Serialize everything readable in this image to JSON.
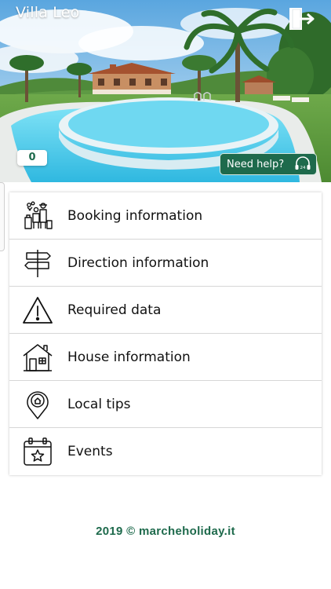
{
  "header": {
    "title": "Villa Leo",
    "exit_icon": "logout-icon"
  },
  "hero": {
    "counter": "0",
    "help_label": "Need help?",
    "help_icon": "headset-24-icon"
  },
  "menu": {
    "items": [
      {
        "label": "Booking information",
        "icon": "travelers-icon"
      },
      {
        "label": "Direction information",
        "icon": "signpost-icon"
      },
      {
        "label": "Required data",
        "icon": "warning-icon"
      },
      {
        "label": "House information",
        "icon": "house-icon"
      },
      {
        "label": "Local tips",
        "icon": "location-pin-icon"
      },
      {
        "label": "Events",
        "icon": "calendar-star-icon"
      }
    ]
  },
  "footer": {
    "copyright": "2019 © marcheholiday.it"
  },
  "colors": {
    "brand_green": "#1e6a4c",
    "pool_blue": "#5fd0ee",
    "text": "#111111"
  }
}
